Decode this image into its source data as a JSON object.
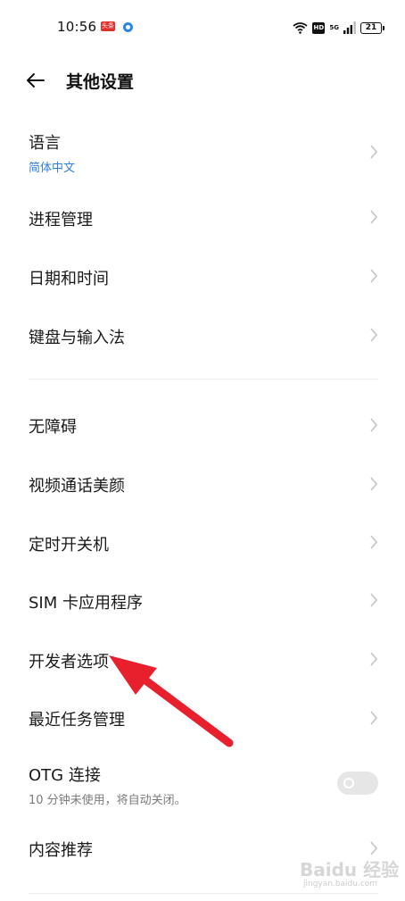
{
  "status_bar": {
    "time": "10:56",
    "notif_badge": "头条",
    "hd": "HD",
    "network": "5G",
    "battery": "21"
  },
  "header": {
    "title": "其他设置"
  },
  "groups": [
    {
      "items": [
        {
          "label": "语言",
          "sub": "简体中文"
        },
        {
          "label": "进程管理"
        },
        {
          "label": "日期和时间"
        },
        {
          "label": "键盘与输入法"
        }
      ]
    },
    {
      "items": [
        {
          "label": "无障碍"
        },
        {
          "label": "视频通话美颜"
        },
        {
          "label": "定时开关机"
        },
        {
          "label": "SIM 卡应用程序"
        },
        {
          "label": "开发者选项"
        },
        {
          "label": "最近任务管理"
        },
        {
          "label": "OTG 连接",
          "sub": "10 分钟未使用，将自动关闭。",
          "toggle": false
        },
        {
          "label": "内容推荐"
        }
      ]
    }
  ],
  "watermark": {
    "brand": "Baidu 经验",
    "url": "jingyan.baidu.com"
  },
  "colors": {
    "accent": "#2f7fe0",
    "annotation_arrow": "#e8202e"
  }
}
